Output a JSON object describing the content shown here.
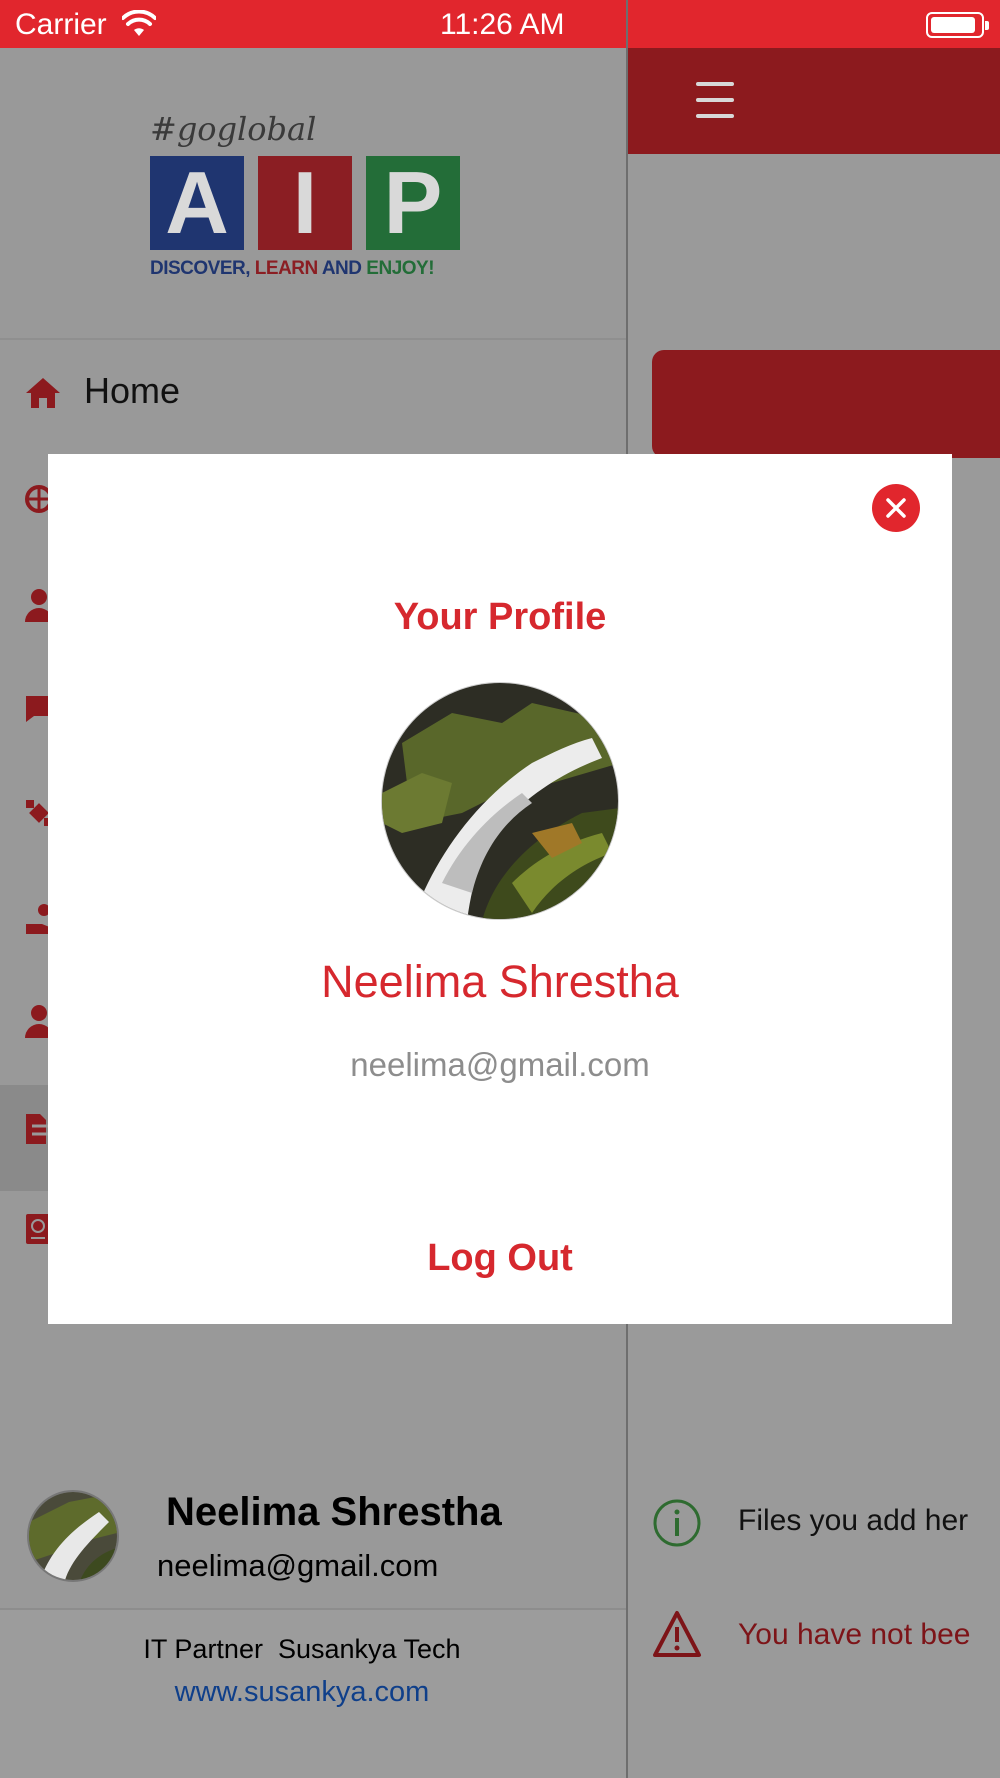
{
  "status_bar": {
    "carrier": "Carrier",
    "time": "11:26 AM"
  },
  "logo": {
    "tagline": "#goglobal",
    "letters": [
      "A",
      "I",
      "P"
    ],
    "slogan_part1": "DISCOVER,",
    "slogan_part2": " LEARN",
    "slogan_part3": " AND",
    "slogan_part4": " ENJOY!"
  },
  "drawer": {
    "home_label": "Home",
    "user_name": "Neelima Shrestha",
    "user_email": "neelima@gmail.com",
    "partner_text": "IT Partner  Susankya Tech",
    "website": "www.susankya.com"
  },
  "main": {
    "info_text": "Files you add her",
    "warning_text": "You have not bee"
  },
  "profile_modal": {
    "title": "Your Profile",
    "name": "Neelima Shrestha",
    "email": "neelima@gmail.com",
    "logout_label": "Log Out"
  },
  "colors": {
    "brand_red": "#e1262d",
    "text_red": "#d6282e",
    "info_green": "#2e7d32"
  }
}
